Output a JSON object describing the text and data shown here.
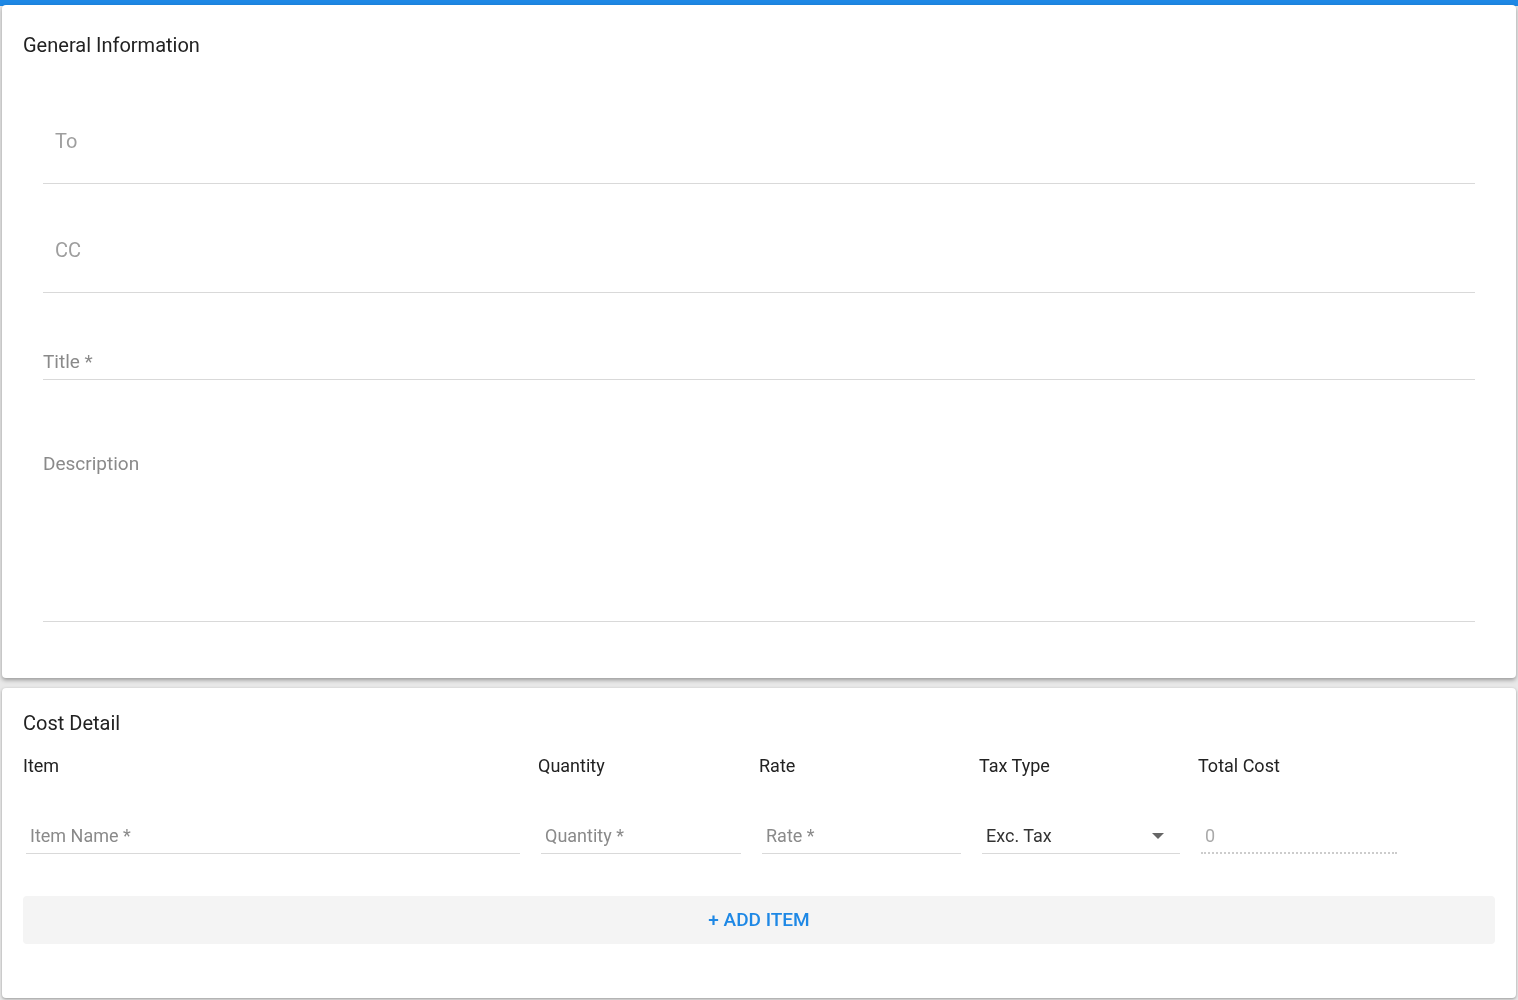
{
  "general": {
    "title": "General Information",
    "fields": [
      {
        "kind": "padded",
        "placeholder": "To"
      },
      {
        "kind": "padded",
        "placeholder": "CC"
      },
      {
        "kind": "line",
        "placeholder": "Title *"
      },
      {
        "kind": "area",
        "placeholder": "Description"
      }
    ]
  },
  "cost": {
    "title": "Cost Detail",
    "columns": [
      "Item",
      "Quantity",
      "Rate",
      "Tax Type",
      "Total Cost"
    ],
    "row": [
      {
        "kind": "input",
        "placeholder": "Item Name *"
      },
      {
        "kind": "input",
        "placeholder": "Quantity *"
      },
      {
        "kind": "input",
        "placeholder": "Rate *"
      },
      {
        "kind": "select",
        "value": "Exc. Tax"
      },
      {
        "kind": "input",
        "value": "0",
        "disabled": true
      }
    ],
    "add_button": "+ ADD ITEM"
  }
}
